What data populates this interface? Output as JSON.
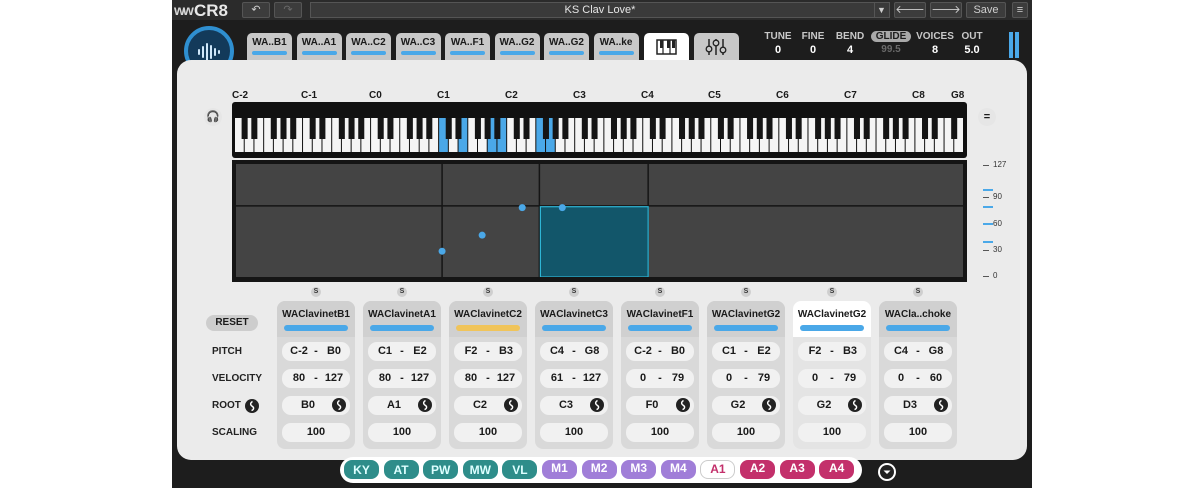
{
  "window": {
    "logo": "CR8",
    "preset_name": "KS Clav Love*",
    "save_label": "Save"
  },
  "slot_tabs": [
    {
      "label": "WA..B1",
      "color": "#4aa8e8"
    },
    {
      "label": "WA..A1",
      "color": "#4aa8e8"
    },
    {
      "label": "WA..C2",
      "color": "#4aa8e8"
    },
    {
      "label": "WA..C3",
      "color": "#4aa8e8"
    },
    {
      "label": "WA..F1",
      "color": "#4aa8e8"
    },
    {
      "label": "WA..G2",
      "color": "#4aa8e8"
    },
    {
      "label": "WA..G2",
      "color": "#4aa8e8"
    },
    {
      "label": "WA..ke",
      "color": "#4aa8e8"
    }
  ],
  "view_tabs": [
    {
      "name": "keyboard-view",
      "icon": "piano-keys-icon",
      "active": true
    },
    {
      "name": "mixer-view",
      "icon": "sliders-icon",
      "active": false
    }
  ],
  "globals": {
    "tune": {
      "label": "TUNE",
      "value": "0"
    },
    "fine": {
      "label": "FINE",
      "value": "0"
    },
    "bend": {
      "label": "BEND",
      "value": "4"
    },
    "glide": {
      "label": "GLIDE",
      "value": "99.5"
    },
    "voices": {
      "label": "VOICES",
      "value": "8"
    },
    "out": {
      "label": "OUT",
      "value": "5.0"
    }
  },
  "note_labels": [
    "C-2",
    "C-1",
    "C0",
    "C1",
    "C2",
    "C3",
    "C4",
    "C5",
    "C6",
    "C7",
    "C8",
    "G8"
  ],
  "velocity_scale": [
    "127",
    "90",
    "60",
    "30",
    "0"
  ],
  "keyboard_highlight_keys": [
    "C1",
    "E1",
    "A1",
    "B1",
    "F2",
    "G2"
  ],
  "reset_label": "RESET",
  "row_labels": {
    "pitch": "PITCH",
    "velocity": "VELOCITY",
    "root": "ROOT",
    "scaling": "SCALING"
  },
  "solo_label": "S",
  "zones": [
    {
      "name": "WAClavinetB1",
      "bar_color": "#4aa8e8",
      "pitch_low": "C-2",
      "pitch_high": "B0",
      "vel_low": "80",
      "vel_high": "127",
      "root": "B0",
      "scaling": "100",
      "selected": false
    },
    {
      "name": "WAClavinetA1",
      "bar_color": "#4aa8e8",
      "pitch_low": "C1",
      "pitch_high": "E2",
      "vel_low": "80",
      "vel_high": "127",
      "root": "A1",
      "scaling": "100",
      "selected": false
    },
    {
      "name": "WAClavinetC2",
      "bar_color": "#f0c45a",
      "pitch_low": "F2",
      "pitch_high": "B3",
      "vel_low": "80",
      "vel_high": "127",
      "root": "C2",
      "scaling": "100",
      "selected": false
    },
    {
      "name": "WAClavinetC3",
      "bar_color": "#4aa8e8",
      "pitch_low": "C4",
      "pitch_high": "G8",
      "vel_low": "61",
      "vel_high": "127",
      "root": "C3",
      "scaling": "100",
      "selected": false
    },
    {
      "name": "WAClavinetF1",
      "bar_color": "#4aa8e8",
      "pitch_low": "C-2",
      "pitch_high": "B0",
      "vel_low": "0",
      "vel_high": "79",
      "root": "F0",
      "scaling": "100",
      "selected": false
    },
    {
      "name": "WAClavinetG2",
      "bar_color": "#4aa8e8",
      "pitch_low": "C1",
      "pitch_high": "E2",
      "vel_low": "0",
      "vel_high": "79",
      "root": "G2",
      "scaling": "100",
      "selected": false
    },
    {
      "name": "WAClavinetG2",
      "bar_color": "#4aa8e8",
      "pitch_low": "F2",
      "pitch_high": "B3",
      "vel_low": "0",
      "vel_high": "79",
      "root": "G2",
      "scaling": "100",
      "selected": true
    },
    {
      "name": "WACla..choke",
      "bar_color": "#4aa8e8",
      "pitch_low": "C4",
      "pitch_high": "G8",
      "vel_low": "0",
      "vel_high": "60",
      "root": "D3",
      "scaling": "100",
      "selected": false
    }
  ],
  "mod_chips": [
    {
      "label": "KY",
      "kind": "t"
    },
    {
      "label": "AT",
      "kind": "t"
    },
    {
      "label": "PW",
      "kind": "t"
    },
    {
      "label": "MW",
      "kind": "t"
    },
    {
      "label": "VL",
      "kind": "t"
    },
    {
      "label": "M1",
      "kind": "m"
    },
    {
      "label": "M2",
      "kind": "m"
    },
    {
      "label": "M3",
      "kind": "m"
    },
    {
      "label": "M4",
      "kind": "m"
    },
    {
      "label": "A1",
      "kind": "a",
      "active": true
    },
    {
      "label": "A2",
      "kind": "a"
    },
    {
      "label": "A3",
      "kind": "a"
    },
    {
      "label": "A4",
      "kind": "a"
    }
  ],
  "colors": {
    "accent": "#4aa8e8",
    "slot_tab_bg": "#c8c8c8",
    "panel_bg": "#ebebeb",
    "chip_teal": "#2e8d8a",
    "chip_purple": "#a07ed8",
    "chip_magenta": "#c3306b"
  }
}
